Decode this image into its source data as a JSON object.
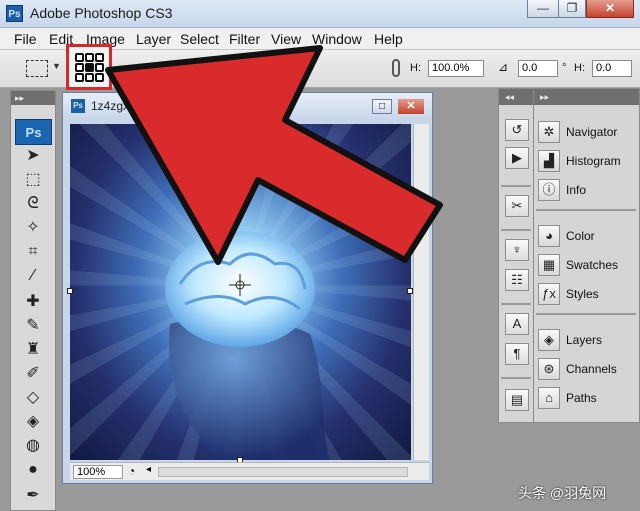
{
  "window": {
    "title": "Adobe Photoshop CS3",
    "minimize": "—",
    "restore": "❐",
    "close": "✕"
  },
  "app_icon": "Ps",
  "menu": [
    "File",
    "Edit",
    "Image",
    "Layer",
    "Select",
    "Filter",
    "View",
    "Window",
    "Help"
  ],
  "options": {
    "h_label": "H:",
    "h_value": "100.0%",
    "angle_value": "0.0",
    "deg": "°",
    "h2_label": "H:",
    "h2_value": "0.0"
  },
  "toolbox": {
    "badge": "Ps"
  },
  "document": {
    "filename": "1z4zgxl.jpg",
    "zoom": "100%"
  },
  "panels": {
    "group1": [
      "Navigator",
      "Histogram",
      "Info"
    ],
    "group2": [
      "Color",
      "Swatches",
      "Styles"
    ],
    "group3": [
      "Layers",
      "Channels",
      "Paths"
    ]
  },
  "watermark": "头条 @羽兔网",
  "colors": {
    "arrow": "#d92b2b",
    "highlight_box": "#d42a2a"
  }
}
